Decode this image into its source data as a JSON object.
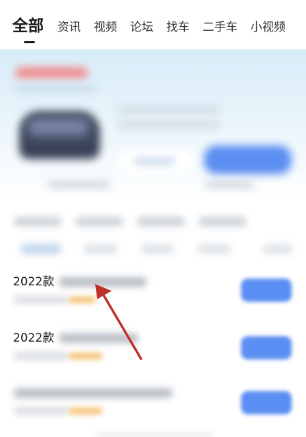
{
  "nav": {
    "tabs": [
      {
        "label": "全部",
        "active": true
      },
      {
        "label": "资讯"
      },
      {
        "label": "视频"
      },
      {
        "label": "论坛"
      },
      {
        "label": "找车"
      },
      {
        "label": "二手车"
      },
      {
        "label": "小视频"
      }
    ]
  },
  "list": {
    "rows": [
      {
        "title": "2022款"
      },
      {
        "title": "2022款"
      },
      {
        "title": ""
      }
    ]
  },
  "colors": {
    "accent_blue": "#5b8ef2",
    "annotation_arrow": "#c0302b",
    "tag_orange": "#f5c47c"
  }
}
